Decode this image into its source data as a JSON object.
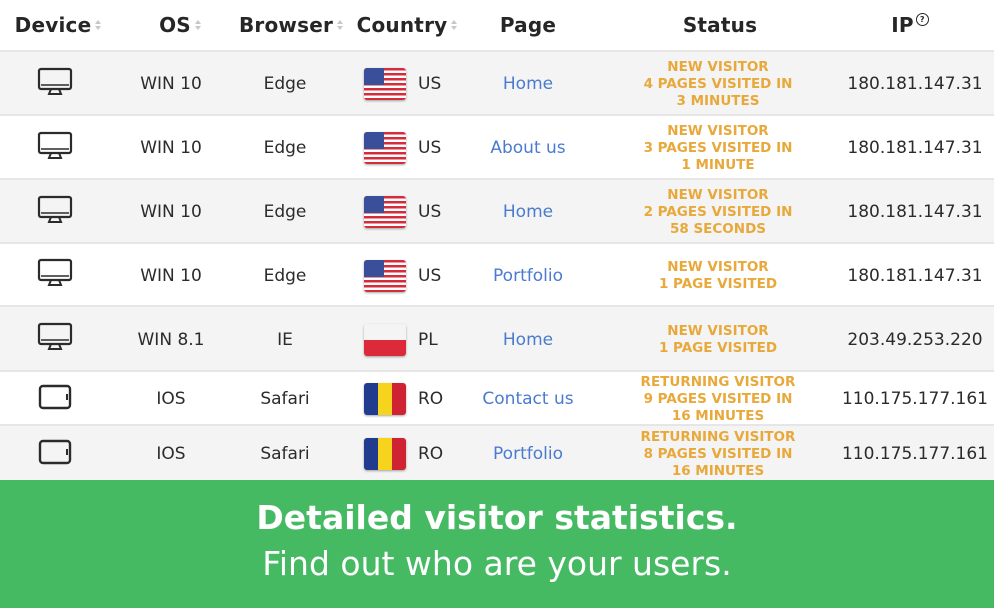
{
  "header": {
    "device": "Device",
    "os": "OS",
    "browser": "Browser",
    "country": "Country",
    "page": "Page",
    "status": "Status",
    "ip": "IP"
  },
  "rows": [
    {
      "device_icon": "desktop-monitor-icon",
      "os": "WIN 10",
      "browser": "Edge",
      "flag": "us-flag-icon",
      "country": "US",
      "page": "Home",
      "status": [
        "NEW VISITOR",
        "4 PAGES VISITED IN",
        "3 MINUTES"
      ],
      "ip": "180.181.147.31"
    },
    {
      "device_icon": "desktop-monitor-icon",
      "os": "WIN 10",
      "browser": "Edge",
      "flag": "us-flag-icon",
      "country": "US",
      "page": "About us",
      "status": [
        "NEW VISITOR",
        "3 PAGES VISITED IN",
        "1 MINUTE"
      ],
      "ip": "180.181.147.31"
    },
    {
      "device_icon": "desktop-monitor-icon",
      "os": "WIN 10",
      "browser": "Edge",
      "flag": "us-flag-icon",
      "country": "US",
      "page": "Home",
      "status": [
        "NEW VISITOR",
        "2 PAGES VISITED IN",
        "58 SECONDS"
      ],
      "ip": "180.181.147.31"
    },
    {
      "device_icon": "desktop-monitor-icon",
      "os": "WIN 10",
      "browser": "Edge",
      "flag": "us-flag-icon",
      "country": "US",
      "page": "Portfolio",
      "status": [
        "NEW VISITOR",
        "1 PAGE VISITED"
      ],
      "ip": "180.181.147.31"
    },
    {
      "device_icon": "desktop-monitor-icon",
      "os": "WIN 8.1",
      "browser": "IE",
      "flag": "pl-flag-icon",
      "country": "PL",
      "page": "Home",
      "status": [
        "NEW VISITOR",
        "1 PAGE VISITED"
      ],
      "ip": "203.49.253.220"
    },
    {
      "device_icon": "tablet-icon",
      "os": "IOS",
      "browser": "Safari",
      "flag": "ro-flag-icon",
      "country": "RO",
      "page": "Contact us",
      "status": [
        "RETURNING VISITOR",
        "9 PAGES VISITED IN",
        "16 MINUTES"
      ],
      "ip": "110.175.177.161"
    },
    {
      "device_icon": "tablet-icon",
      "os": "IOS",
      "browser": "Safari",
      "flag": "ro-flag-icon",
      "country": "RO",
      "page": "Portfolio",
      "status": [
        "RETURNING VISITOR",
        "8 PAGES VISITED IN",
        "16 MINUTES"
      ],
      "ip": "110.175.177.161"
    }
  ],
  "banner": {
    "headline": "Detailed visitor statistics.",
    "subline": "Find out who are your users."
  },
  "colors": {
    "banner_green": "#46ba63",
    "status_orange": "#e8a83a",
    "link_blue": "#4a7bd0",
    "row_alt": "#f4f4f4"
  }
}
